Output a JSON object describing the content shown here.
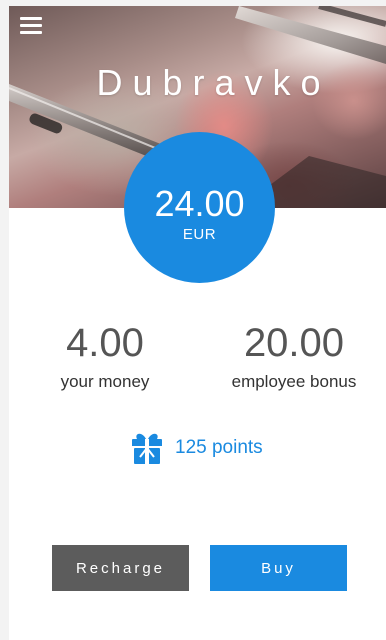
{
  "header": {
    "user_name": "Dubravko"
  },
  "balance": {
    "amount": "24.00",
    "currency": "EUR"
  },
  "stats": {
    "own_money": {
      "value": "4.00",
      "label": "your money"
    },
    "bonus": {
      "value": "20.00",
      "label": "employee bonus"
    }
  },
  "points": {
    "text": "125 points",
    "icon": "gift-icon"
  },
  "actions": {
    "recharge_label": "Recharge",
    "buy_label": "Buy"
  },
  "colors": {
    "accent": "#1a8ae0",
    "secondary_button": "#5c5c5c",
    "text_dark": "#333333",
    "text_muted": "#555555"
  }
}
